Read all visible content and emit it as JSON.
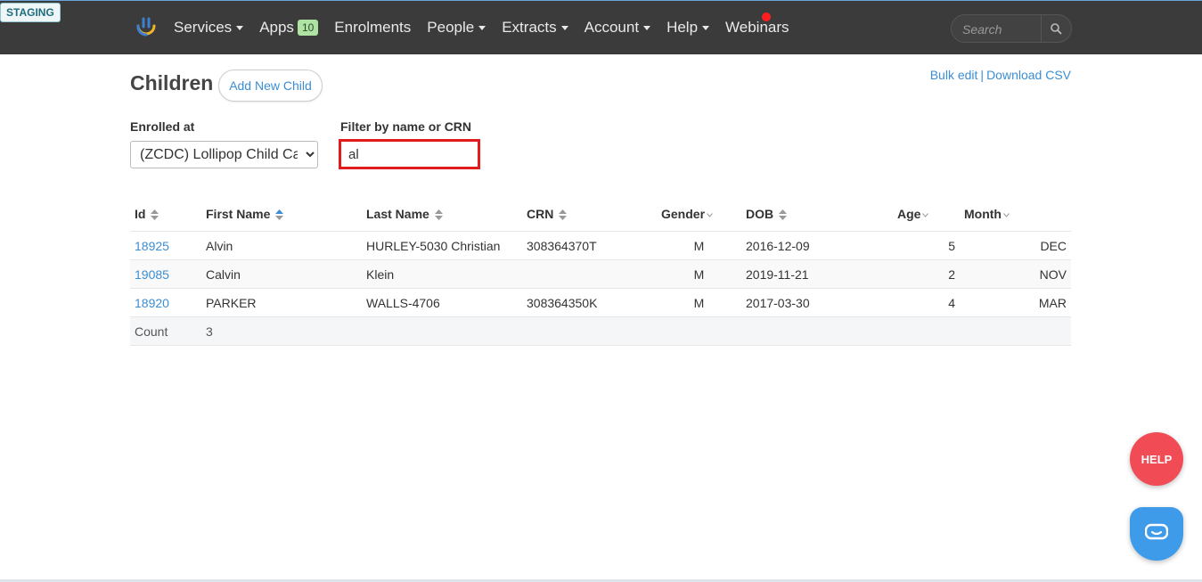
{
  "env_badge": "STAGING",
  "nav": {
    "items": [
      {
        "label": "Services",
        "has_caret": true
      },
      {
        "label": "Apps",
        "badge": "10"
      },
      {
        "label": "Enrolments"
      },
      {
        "label": "People",
        "has_caret": true
      },
      {
        "label": "Extracts",
        "has_caret": true
      },
      {
        "label": "Account",
        "has_caret": true
      },
      {
        "label": "Help",
        "has_caret": true
      },
      {
        "label": "Webinars",
        "notification": true
      }
    ],
    "search_placeholder": "Search"
  },
  "page": {
    "title": "Children",
    "add_button": "Add New Child",
    "bulk_edit": "Bulk edit",
    "link_separator": "|",
    "download_csv": "Download CSV"
  },
  "filters": {
    "enrolled_label": "Enrolled at",
    "enrolled_value": "(ZCDC) Lollipop Child Ca",
    "filter_label": "Filter by name or CRN",
    "filter_value": "al"
  },
  "table": {
    "columns": [
      "Id",
      "First Name",
      "Last Name",
      "CRN",
      "Gender",
      "DOB",
      "Age",
      "Month"
    ],
    "rows": [
      {
        "id": "18925",
        "first": "Alvin",
        "last": "HURLEY-5030 Christian",
        "crn": "308364370T",
        "gender": "M",
        "dob": "2016-12-09",
        "age": "5",
        "month": "DEC"
      },
      {
        "id": "19085",
        "first": "Calvin",
        "last": "Klein",
        "crn": "",
        "gender": "M",
        "dob": "2019-11-21",
        "age": "2",
        "month": "NOV"
      },
      {
        "id": "18920",
        "first": "PARKER",
        "last": "WALLS-4706",
        "crn": "308364350K",
        "gender": "M",
        "dob": "2017-03-30",
        "age": "4",
        "month": "MAR"
      }
    ],
    "count_label": "Count",
    "count_value": "3"
  },
  "widgets": {
    "help_label": "HELP"
  },
  "colors": {
    "navbar": "#3b3b3b",
    "link": "#3b8ed4",
    "highlight_border": "#e21c1c",
    "help_button": "#f14b55",
    "chat_button": "#3d9be9"
  }
}
